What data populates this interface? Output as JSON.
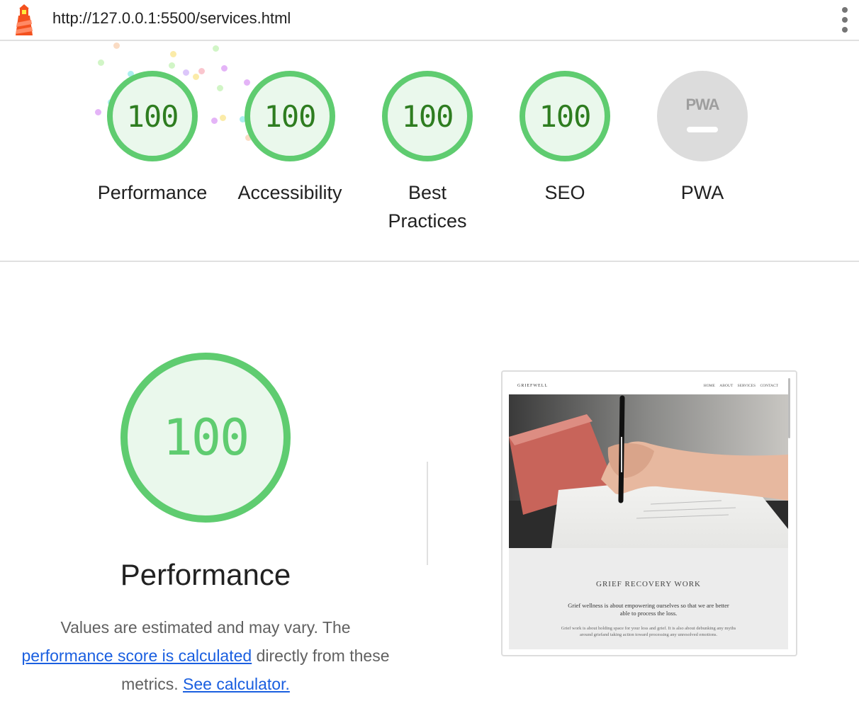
{
  "browser": {
    "url": "http://127.0.0.1:5500/services.html",
    "logo_icon": "lighthouse-icon",
    "menu_icon": "more-vert-icon"
  },
  "colors": {
    "pass": "#5fcc70",
    "pass_text": "#2e7d20",
    "pass_fill": "#eaf8ec",
    "na_fill": "#dcdcdc",
    "link": "#1a5fe0"
  },
  "categories": [
    {
      "score": "100",
      "label": "Performance"
    },
    {
      "score": "100",
      "label": "Accessibility"
    },
    {
      "score": "100",
      "label": "Best Practices"
    },
    {
      "score": "100",
      "label": "SEO"
    },
    {
      "score": "",
      "label": "PWA",
      "badge": "PWA"
    }
  ],
  "performance": {
    "score": "100",
    "title": "Performance",
    "desc_1": "Values are estimated and may vary. The",
    "link_1": "performance score is calculated",
    "desc_2": "directly from these metrics.",
    "link_2": "See calculator."
  },
  "screenshot": {
    "site_logo": "GRIEFWELL",
    "nav": [
      "HOME",
      "ABOUT",
      "SERVICES",
      "CONTACT"
    ],
    "heading": "GRIEF RECOVERY WORK",
    "lead": "Grief wellness is about empowering ourselves so that we are better able to process the loss.",
    "body": "Grief work is about holding space for your loss and grief. It is also about debunking any myths around griefand taking action toward processing any unresolved emotions."
  }
}
